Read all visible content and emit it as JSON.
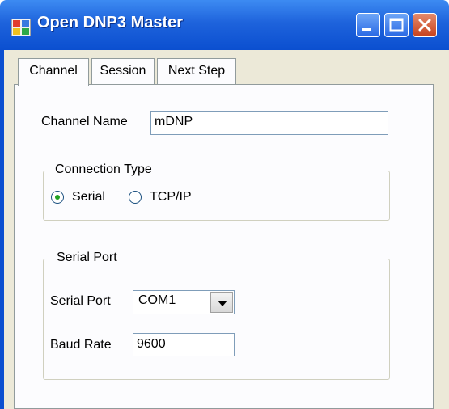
{
  "window": {
    "title": "Open DNP3 Master",
    "icons": {
      "app": "app-icon",
      "minimize": "minimize-icon",
      "maximize": "maximize-icon",
      "close": "close-icon"
    }
  },
  "tabs": [
    {
      "label": "Channel",
      "active": true
    },
    {
      "label": "Session",
      "active": false
    },
    {
      "label": "Next Step",
      "active": false
    }
  ],
  "channel": {
    "channel_name_label": "Channel Name",
    "channel_name_value": "mDNP",
    "connection_type": {
      "legend": "Connection Type",
      "options": [
        {
          "label": "Serial",
          "checked": true
        },
        {
          "label": "TCP/IP",
          "checked": false
        }
      ]
    },
    "serial_port_group": {
      "legend": "Serial Port",
      "serial_port_label": "Serial Port",
      "serial_port_value": "COM1",
      "baud_rate_label": "Baud Rate",
      "baud_rate_value": "9600"
    }
  },
  "colors": {
    "titlebar": "#0b4fd0",
    "client": "#ece9d8",
    "panel": "#fcfcfe",
    "radio_dot": "#21a121"
  }
}
